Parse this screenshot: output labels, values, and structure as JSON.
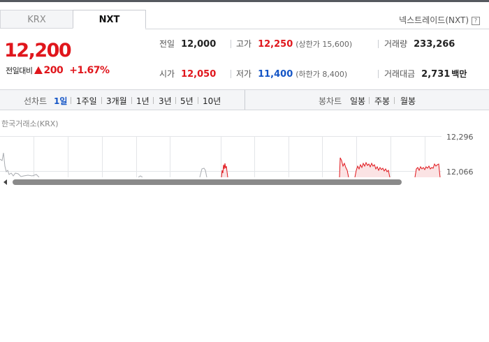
{
  "tabs": [
    {
      "label": "KRX"
    },
    {
      "label": "NXT"
    }
  ],
  "nextrade_link": "넥스트레이드(NXT)",
  "help_icon": "?",
  "quote": {
    "price": "12,200",
    "change_label": "전일대비",
    "change_amount": "200",
    "change_percent": "+1.67%"
  },
  "stats": {
    "prev_close": {
      "label": "전일",
      "value": "12,000"
    },
    "high": {
      "label": "고가",
      "value": "12,250",
      "sub": "(상한가 15,600)"
    },
    "volume": {
      "label": "거래량",
      "value": "233,266"
    },
    "open": {
      "label": "시가",
      "value": "12,050"
    },
    "low": {
      "label": "저가",
      "value": "11,400",
      "sub": "(하한가 8,400)"
    },
    "trade_value": {
      "label": "거래대금",
      "value": "2,731",
      "unit": "백만"
    }
  },
  "period_bar": {
    "line_chart_label": "선차트",
    "line_periods": [
      "1일",
      "1주일",
      "3개월",
      "1년",
      "3년",
      "5년",
      "10년"
    ],
    "active_period": "1일",
    "candle_chart_label": "봉차트",
    "candle_periods": [
      "일봉",
      "주봉",
      "월봉"
    ]
  },
  "chart": {
    "exchange_label": "한국거래소(KRX)",
    "y_ticks": [
      "12,296",
      "12,066"
    ]
  },
  "colors": {
    "up": "#e0161c",
    "down": "#1455c6",
    "active_tab": "#1455c6"
  }
}
